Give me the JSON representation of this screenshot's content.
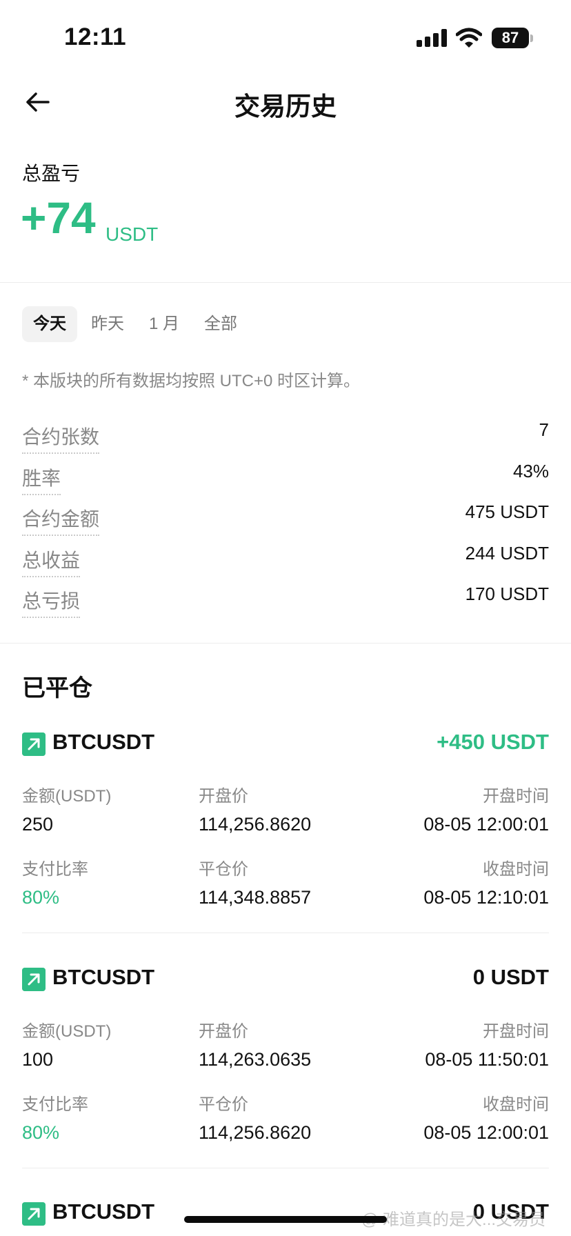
{
  "status_bar": {
    "time": "12:11",
    "battery": "87"
  },
  "header": {
    "title": "交易历史"
  },
  "summary": {
    "label": "总盈亏",
    "value": "+74",
    "unit": "USDT"
  },
  "tabs": [
    {
      "label": "今天",
      "active": true
    },
    {
      "label": "昨天",
      "active": false
    },
    {
      "label": "1 月",
      "active": false
    },
    {
      "label": "全部",
      "active": false
    }
  ],
  "note": "* 本版块的所有数据均按照 UTC+0 时区计算。",
  "stats": [
    {
      "label": "合约张数",
      "value": "7"
    },
    {
      "label": "胜率",
      "value": "43%"
    },
    {
      "label": "合约金额",
      "value": "475 USDT"
    },
    {
      "label": "总收益",
      "value": "244 USDT"
    },
    {
      "label": "总亏损",
      "value": "170 USDT"
    }
  ],
  "closed": {
    "title": "已平仓",
    "labels": {
      "amount": "金额(USDT)",
      "open_price": "开盘价",
      "open_time": "开盘时间",
      "payout": "支付比率",
      "close_price": "平仓价",
      "close_time": "收盘时间"
    },
    "trades": [
      {
        "symbol": "BTCUSDT",
        "pnl": "+450 USDT",
        "positive": true,
        "amount": "250",
        "open_price": "114,256.8620",
        "open_time": "08-05 12:00:01",
        "payout": "80%",
        "close_price": "114,348.8857",
        "close_time": "08-05 12:10:01"
      },
      {
        "symbol": "BTCUSDT",
        "pnl": "0 USDT",
        "positive": false,
        "amount": "100",
        "open_price": "114,263.0635",
        "open_time": "08-05 11:50:01",
        "payout": "80%",
        "close_price": "114,256.8620",
        "close_time": "08-05 12:00:01"
      },
      {
        "symbol": "BTCUSDT",
        "pnl": "0 USDT",
        "positive": false
      }
    ]
  },
  "watermark": "@ 难道真的是大...交易员",
  "colors": {
    "green": "#2ebd85",
    "text": "#111111",
    "muted": "#888888"
  }
}
